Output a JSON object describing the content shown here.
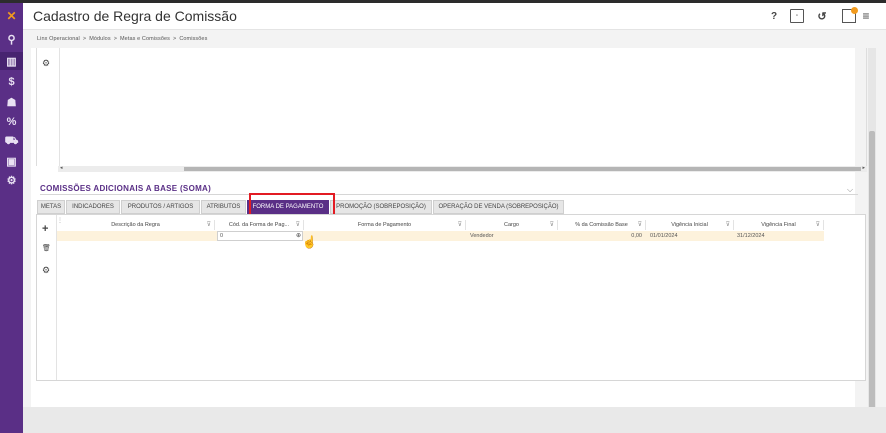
{
  "app": {
    "title": "Cadastro de Regra de Comissão",
    "accent": "#5a2f86"
  },
  "sidebar": {
    "logo": "✕",
    "items": [
      {
        "name": "search-icon",
        "glyph": "⚲"
      },
      {
        "name": "chart-icon",
        "glyph": "▥"
      },
      {
        "name": "dollar-icon",
        "glyph": "$"
      },
      {
        "name": "users-icon",
        "glyph": "☗"
      },
      {
        "name": "percent-icon",
        "glyph": "%"
      },
      {
        "name": "cart-icon",
        "glyph": "⛟"
      },
      {
        "name": "monitor-icon",
        "glyph": "▣"
      },
      {
        "name": "settings-icon",
        "glyph": "⚙"
      }
    ]
  },
  "header": {
    "help": "?",
    "save": "▫",
    "undo": "↺",
    "notifications": "▢",
    "menu": "≡"
  },
  "breadcrumb": [
    "Linx Operacional",
    "Módulos",
    "Metas e Comissões",
    "Comissões"
  ],
  "upper_grid": {
    "gear": "⚙",
    "left_arrow": "◂",
    "right_arrow": "▸"
  },
  "section": {
    "title": "COMISSÕES ADICIONAIS A BASE (SOMA)",
    "chevron": "⌵"
  },
  "tabs": [
    "METAS",
    "INDICADORES",
    "PRODUTOS / ARTIGOS",
    "ATRIBUTOS",
    "FORMA DE PAGAMENTO",
    "PROMOÇÃO (SOBREPOSIÇÃO)",
    "OPERAÇÃO DE VENDA (SOBREPOSIÇÃO)"
  ],
  "grid": {
    "tools": {
      "add": "+",
      "delete": "🗑",
      "settings": "⚙"
    },
    "filter_glyph": "⊽",
    "columns": [
      "Descrição da Regra",
      "Cód. da Forma de Pag...",
      "Forma de Pagamento",
      "Cargo",
      "% da Comissão Base",
      "Vigência Inicial",
      "Vigência Final"
    ],
    "row": {
      "descricao": "",
      "cod_forma": "0",
      "forma": "",
      "cargo": "Vendedor",
      "comissao": "0,00",
      "vigencia_inicial": "01/01/2024",
      "vigencia_final": "31/12/2024"
    },
    "lookup_icon": "⊕",
    "cursor": "☝"
  }
}
